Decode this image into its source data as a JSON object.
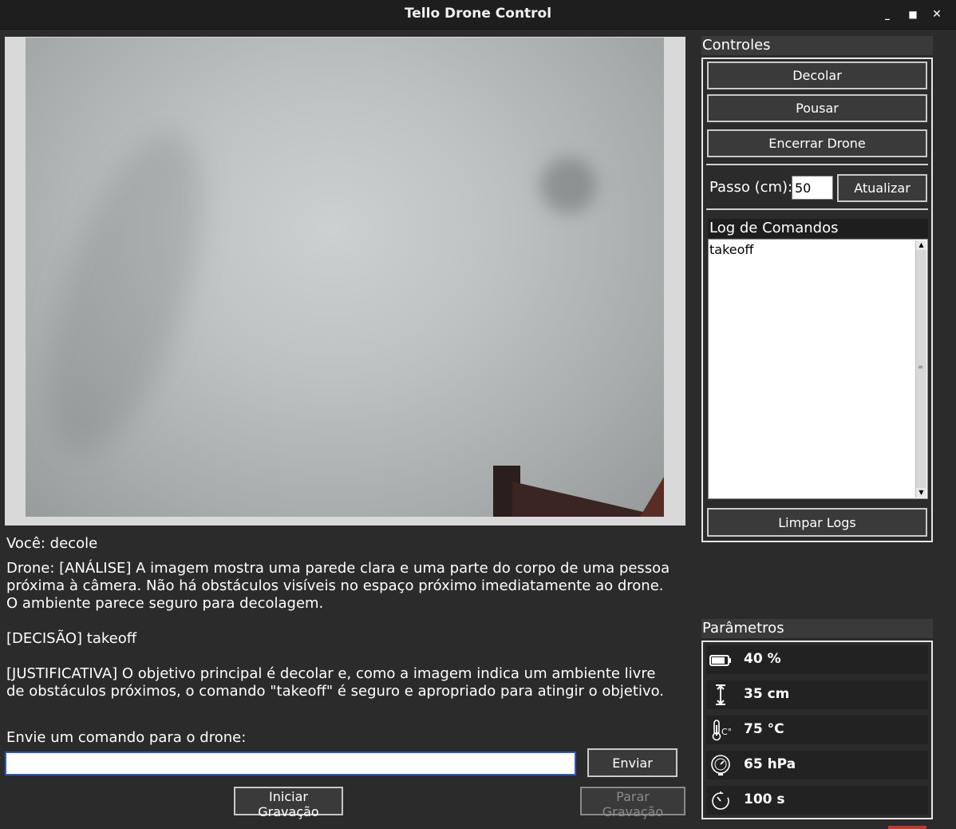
{
  "window": {
    "title": "Tello Drone Control",
    "min_glyph": "_",
    "max_glyph": "■",
    "close_glyph": "✕"
  },
  "chat": {
    "user_line": "Você: decole",
    "drone_analysis": "Drone: [ANÁLISE] A imagem mostra uma parede clara e uma parte do corpo de uma pessoa\npróxima à câmera.  Não há obstáculos visíveis no espaço próximo imediatamente ao drone.\nO ambiente parece seguro para decolagem.",
    "decision": "[DECISÃO] takeoff",
    "justification": "[JUSTIFICATIVA] O objetivo principal é decolar e, como a imagem indica um ambiente livre\nde obstáculos próximos, o comando \"takeoff\" é seguro e apropriado para atingir o objetivo."
  },
  "command": {
    "label": "Envie um comando para o drone:",
    "value": "",
    "send_label": "Enviar",
    "start_recording_label": "Iniciar Gravação",
    "stop_recording_label": "Parar Gravação"
  },
  "controls": {
    "title": "Controles",
    "takeoff_label": "Decolar",
    "land_label": "Pousar",
    "shutdown_label": "Encerrar Drone",
    "step_label": "Passo (cm):",
    "step_value": "50",
    "update_label": "Atualizar",
    "log_title": "Log de Comandos",
    "log_entries": "takeoff",
    "clear_logs_label": "Limpar Logs"
  },
  "parameters": {
    "title": "Parâmetros",
    "battery": "40 %",
    "height": "35 cm",
    "temperature": "75 °C",
    "pressure": "65 hPa",
    "flight_time": "100 s"
  },
  "colors": {
    "background": "#2b2b2b",
    "titlebar": "#1e1e1e",
    "input_focus": "#2f5bb7"
  }
}
